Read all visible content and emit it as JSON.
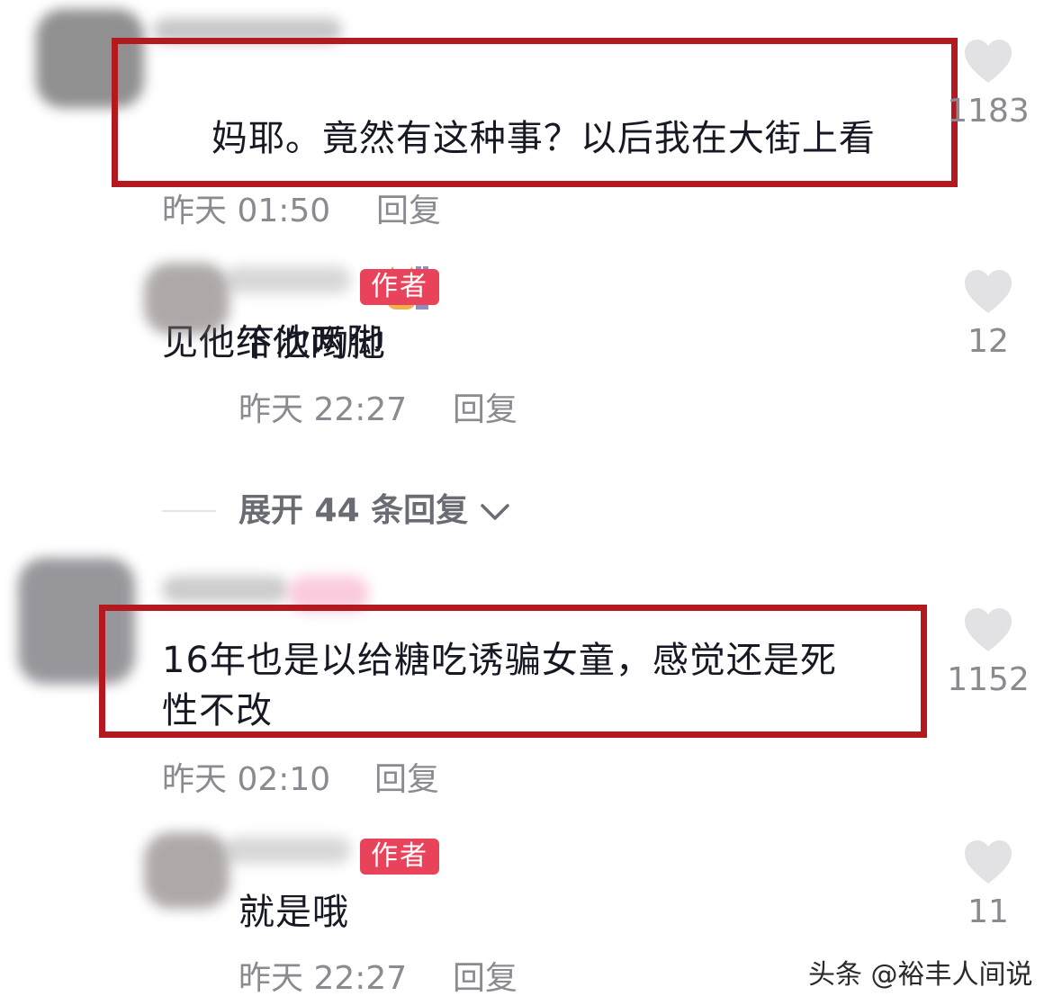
{
  "comments": [
    {
      "text": "妈耶。竟然有这种事？以后我在大街上看\n见他给他两脚",
      "emoji": "cat-peeking-wall-emoji",
      "time": "昨天 01:50",
      "reply_label": "回复",
      "likes": "1183",
      "highlighted": true,
      "replies": [
        {
          "badge": "作者",
          "text": "下次哟他",
          "time": "昨天 22:27",
          "reply_label": "回复",
          "likes": "12"
        }
      ],
      "expand_label": "展开 44 条回复"
    },
    {
      "text": "16年也是以给糖吃诱骗女童，感觉还是死\n性不改",
      "time": "昨天 02:10",
      "reply_label": "回复",
      "likes": "1152",
      "highlighted": true,
      "replies": [
        {
          "badge": "作者",
          "text": "就是哦",
          "time": "昨天 22:27",
          "reply_label": "回复",
          "likes": "11"
        }
      ]
    }
  ],
  "watermark": "头条 @裕丰人间说",
  "colors": {
    "highlight_border": "#b3191f",
    "author_badge": "#e8435a",
    "meta_text": "#8a8b91",
    "like_icon": "#e2e2e4"
  }
}
